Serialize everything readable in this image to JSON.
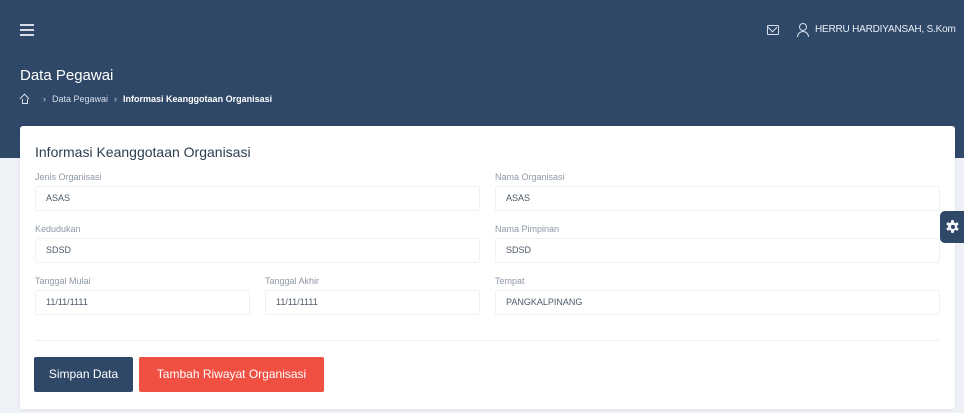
{
  "topbar": {
    "menu_icon": "menu-icon",
    "mail_icon": "mail-icon",
    "user_icon": "user-icon",
    "user_name": "HERRU HARDIYANSAH, S.Kom"
  },
  "page": {
    "title": "Data Pegawai",
    "breadcrumb": {
      "home_icon": "home-icon",
      "items": [
        "Data Pegawai",
        "Informasi Keanggotaan Organisasi"
      ]
    }
  },
  "form": {
    "title": "Informasi Keanggotaan Organisasi",
    "fields": {
      "jenis_organisasi": {
        "label": "Jenis Organisasi",
        "value": "ASAS"
      },
      "nama_organisasi": {
        "label": "Nama Organisasi",
        "value": "ASAS"
      },
      "kedudukan": {
        "label": "Kedudukan",
        "value": "SDSD"
      },
      "nama_pimpinan": {
        "label": "Nama Pimpinan",
        "value": "SDSD"
      },
      "tanggal_mulai": {
        "label": "Tanggal Mulai",
        "value": "11/11/1111"
      },
      "tanggal_akhir": {
        "label": "Tanggal Akhir",
        "value": "11/11/1111"
      },
      "tempat": {
        "label": "Tempat",
        "value": "PANGKALPINANG"
      }
    },
    "buttons": {
      "save_label": "Simpan Data",
      "add_label": "Tambah Riwayat Organisasi"
    }
  },
  "settings": {
    "icon": "gear-icon"
  },
  "colors": {
    "header": "#2f4868",
    "primary_button": "#2f4868",
    "danger_button": "#f05042",
    "background": "#eef1f5"
  }
}
